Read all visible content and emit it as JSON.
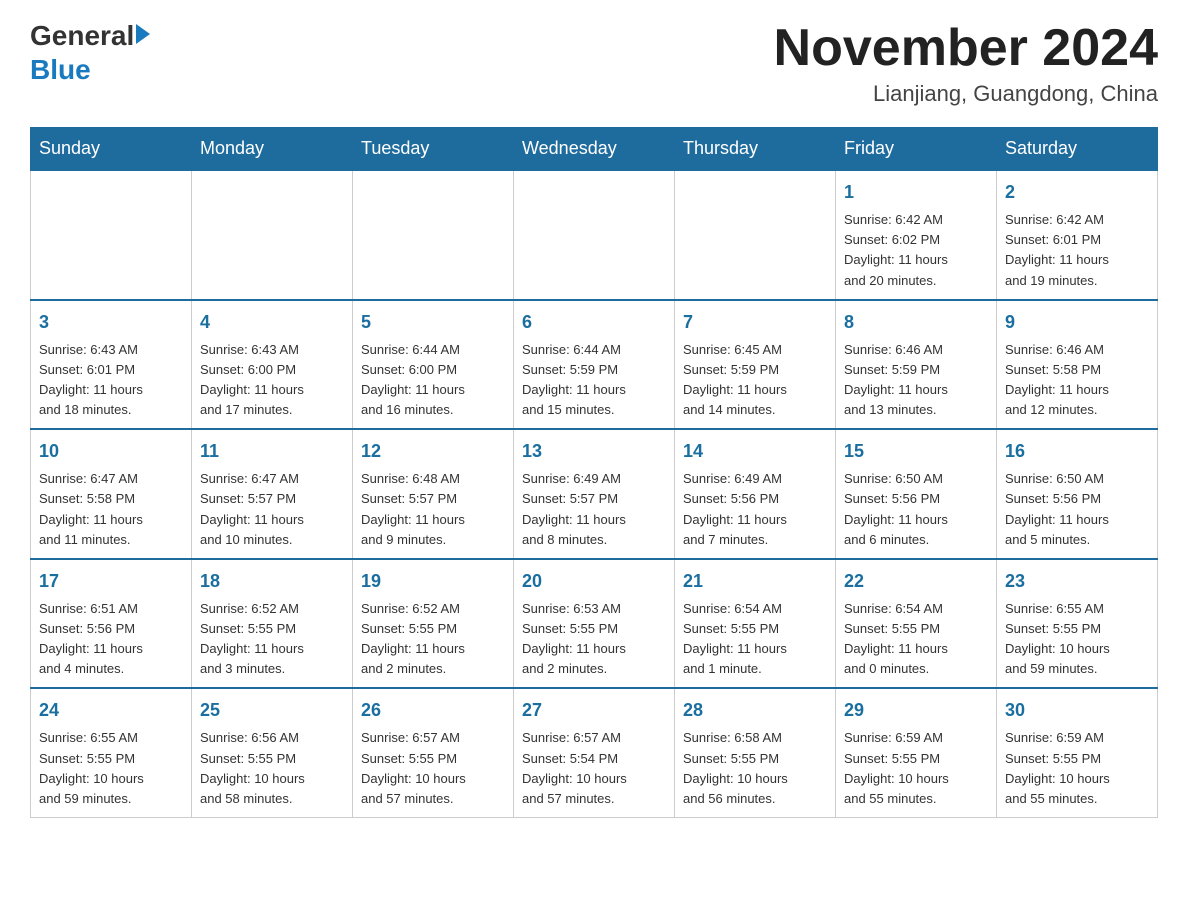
{
  "header": {
    "logo_general": "General",
    "logo_blue": "Blue",
    "month_title": "November 2024",
    "location": "Lianjiang, Guangdong, China"
  },
  "weekdays": [
    "Sunday",
    "Monday",
    "Tuesday",
    "Wednesday",
    "Thursday",
    "Friday",
    "Saturday"
  ],
  "weeks": [
    [
      {
        "day": "",
        "info": ""
      },
      {
        "day": "",
        "info": ""
      },
      {
        "day": "",
        "info": ""
      },
      {
        "day": "",
        "info": ""
      },
      {
        "day": "",
        "info": ""
      },
      {
        "day": "1",
        "info": "Sunrise: 6:42 AM\nSunset: 6:02 PM\nDaylight: 11 hours\nand 20 minutes."
      },
      {
        "day": "2",
        "info": "Sunrise: 6:42 AM\nSunset: 6:01 PM\nDaylight: 11 hours\nand 19 minutes."
      }
    ],
    [
      {
        "day": "3",
        "info": "Sunrise: 6:43 AM\nSunset: 6:01 PM\nDaylight: 11 hours\nand 18 minutes."
      },
      {
        "day": "4",
        "info": "Sunrise: 6:43 AM\nSunset: 6:00 PM\nDaylight: 11 hours\nand 17 minutes."
      },
      {
        "day": "5",
        "info": "Sunrise: 6:44 AM\nSunset: 6:00 PM\nDaylight: 11 hours\nand 16 minutes."
      },
      {
        "day": "6",
        "info": "Sunrise: 6:44 AM\nSunset: 5:59 PM\nDaylight: 11 hours\nand 15 minutes."
      },
      {
        "day": "7",
        "info": "Sunrise: 6:45 AM\nSunset: 5:59 PM\nDaylight: 11 hours\nand 14 minutes."
      },
      {
        "day": "8",
        "info": "Sunrise: 6:46 AM\nSunset: 5:59 PM\nDaylight: 11 hours\nand 13 minutes."
      },
      {
        "day": "9",
        "info": "Sunrise: 6:46 AM\nSunset: 5:58 PM\nDaylight: 11 hours\nand 12 minutes."
      }
    ],
    [
      {
        "day": "10",
        "info": "Sunrise: 6:47 AM\nSunset: 5:58 PM\nDaylight: 11 hours\nand 11 minutes."
      },
      {
        "day": "11",
        "info": "Sunrise: 6:47 AM\nSunset: 5:57 PM\nDaylight: 11 hours\nand 10 minutes."
      },
      {
        "day": "12",
        "info": "Sunrise: 6:48 AM\nSunset: 5:57 PM\nDaylight: 11 hours\nand 9 minutes."
      },
      {
        "day": "13",
        "info": "Sunrise: 6:49 AM\nSunset: 5:57 PM\nDaylight: 11 hours\nand 8 minutes."
      },
      {
        "day": "14",
        "info": "Sunrise: 6:49 AM\nSunset: 5:56 PM\nDaylight: 11 hours\nand 7 minutes."
      },
      {
        "day": "15",
        "info": "Sunrise: 6:50 AM\nSunset: 5:56 PM\nDaylight: 11 hours\nand 6 minutes."
      },
      {
        "day": "16",
        "info": "Sunrise: 6:50 AM\nSunset: 5:56 PM\nDaylight: 11 hours\nand 5 minutes."
      }
    ],
    [
      {
        "day": "17",
        "info": "Sunrise: 6:51 AM\nSunset: 5:56 PM\nDaylight: 11 hours\nand 4 minutes."
      },
      {
        "day": "18",
        "info": "Sunrise: 6:52 AM\nSunset: 5:55 PM\nDaylight: 11 hours\nand 3 minutes."
      },
      {
        "day": "19",
        "info": "Sunrise: 6:52 AM\nSunset: 5:55 PM\nDaylight: 11 hours\nand 2 minutes."
      },
      {
        "day": "20",
        "info": "Sunrise: 6:53 AM\nSunset: 5:55 PM\nDaylight: 11 hours\nand 2 minutes."
      },
      {
        "day": "21",
        "info": "Sunrise: 6:54 AM\nSunset: 5:55 PM\nDaylight: 11 hours\nand 1 minute."
      },
      {
        "day": "22",
        "info": "Sunrise: 6:54 AM\nSunset: 5:55 PM\nDaylight: 11 hours\nand 0 minutes."
      },
      {
        "day": "23",
        "info": "Sunrise: 6:55 AM\nSunset: 5:55 PM\nDaylight: 10 hours\nand 59 minutes."
      }
    ],
    [
      {
        "day": "24",
        "info": "Sunrise: 6:55 AM\nSunset: 5:55 PM\nDaylight: 10 hours\nand 59 minutes."
      },
      {
        "day": "25",
        "info": "Sunrise: 6:56 AM\nSunset: 5:55 PM\nDaylight: 10 hours\nand 58 minutes."
      },
      {
        "day": "26",
        "info": "Sunrise: 6:57 AM\nSunset: 5:55 PM\nDaylight: 10 hours\nand 57 minutes."
      },
      {
        "day": "27",
        "info": "Sunrise: 6:57 AM\nSunset: 5:54 PM\nDaylight: 10 hours\nand 57 minutes."
      },
      {
        "day": "28",
        "info": "Sunrise: 6:58 AM\nSunset: 5:55 PM\nDaylight: 10 hours\nand 56 minutes."
      },
      {
        "day": "29",
        "info": "Sunrise: 6:59 AM\nSunset: 5:55 PM\nDaylight: 10 hours\nand 55 minutes."
      },
      {
        "day": "30",
        "info": "Sunrise: 6:59 AM\nSunset: 5:55 PM\nDaylight: 10 hours\nand 55 minutes."
      }
    ]
  ]
}
